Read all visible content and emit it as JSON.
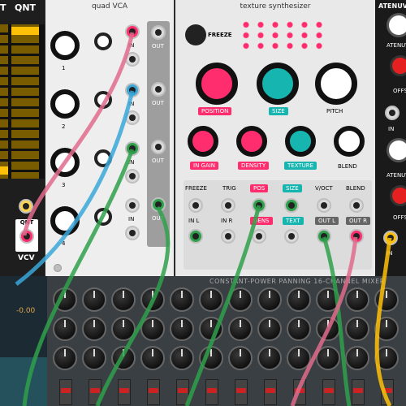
{
  "quantizer": {
    "title": "QNT",
    "partial_title": "T",
    "jack_label": "QNT",
    "brand": "VCV"
  },
  "quad_vca": {
    "title": "quad VCA",
    "channels": [
      "1",
      "2",
      "3",
      "4"
    ],
    "in_label": "IN",
    "out_label": "OUT"
  },
  "texture": {
    "title": "texture synthesizer",
    "freeze_label": "FREEZE",
    "position_label": "POSITION",
    "size_label": "SIZE",
    "pitch_label": "PITCH",
    "in_gain_label": "IN GAIN",
    "density_label": "DENSITY",
    "texture_label": "TEXTURE",
    "blend_label": "BLEND",
    "cv_labels": [
      "FREEZE",
      "TRIG",
      "POS",
      "SIZE",
      "V/OCT",
      "BLEND"
    ],
    "in_labels": [
      "IN L",
      "IN R",
      "DENS",
      "TEXT",
      "OUT L",
      "OUT R"
    ]
  },
  "atenuverter": {
    "title": "ATENUV",
    "labels": [
      "ATENUVE",
      "OFFS",
      "IN",
      "ATENUVE",
      "OFFS",
      "IN"
    ]
  },
  "mixer": {
    "title": "CONSTANT-POWER PANNING 16-CHANNEL MIXER"
  },
  "scope": {
    "readout": "-0.00"
  },
  "colors": {
    "accent_pink": "#ff2d6e",
    "accent_teal": "#16b5b0",
    "cable_green": "#2fa04b",
    "cable_pink": "#e06b8b",
    "cable_blue": "#3aa7d8",
    "led_yellow": "#ffc107"
  }
}
